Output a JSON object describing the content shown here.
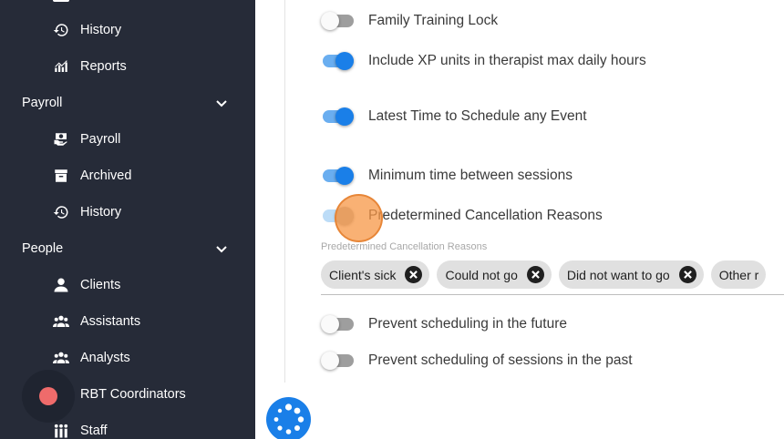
{
  "sidebar": {
    "items": [
      {
        "label": "History",
        "icon": "history-icon"
      },
      {
        "label": "Reports",
        "icon": "reports-chart-icon"
      },
      {
        "label": "Payroll",
        "icon": "payroll-icon"
      },
      {
        "label": "Archived",
        "icon": "archive-icon"
      },
      {
        "label": "History",
        "icon": "history-icon"
      },
      {
        "label": "Clients",
        "icon": "person-icon"
      },
      {
        "label": "Assistants",
        "icon": "group-icon"
      },
      {
        "label": "Analysts",
        "icon": "group-icon"
      },
      {
        "label": "RBT Coordinators",
        "icon": "group-icon"
      },
      {
        "label": "Staff",
        "icon": "staff-icon"
      }
    ],
    "sections": [
      {
        "label": "Payroll",
        "expanded": true
      },
      {
        "label": "People",
        "expanded": true
      }
    ]
  },
  "settings": [
    {
      "label": "Family Training Lock",
      "enabled": false
    },
    {
      "label": "Include XP units in therapist max daily hours",
      "enabled": true
    },
    {
      "label": "Latest Time to Schedule any Event",
      "enabled": true
    },
    {
      "label": "Minimum time between sessions",
      "enabled": true
    },
    {
      "label": "Predetermined Cancellation Reasons",
      "enabled": true
    },
    {
      "label": "Prevent scheduling in the future",
      "enabled": false
    },
    {
      "label": "Prevent scheduling of sessions in the past",
      "enabled": false
    }
  ],
  "cancellation_reasons": {
    "label": "Predetermined Cancellation Reasons",
    "chips": [
      "Client's sick",
      "Could not go",
      "Did not want to go",
      "Other r"
    ]
  },
  "colors": {
    "sidebar_bg": "#262b38",
    "accent": "#1a7fe8",
    "record": "#ef6b6b",
    "cursor": "#f79746"
  }
}
